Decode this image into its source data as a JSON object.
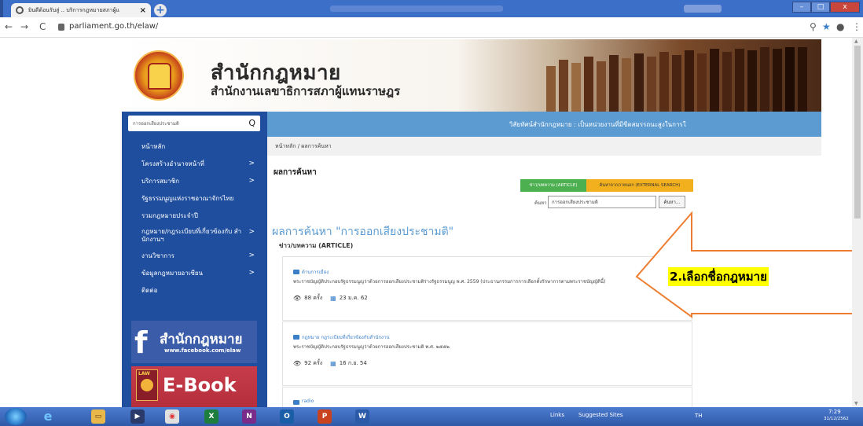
{
  "browser": {
    "tab_title": "ยินดีต้อนรับสู่ .. บริการกฎหมายสภาผู้แ",
    "tab_close": "×",
    "new_tab": "+",
    "back": "←",
    "forward": "→",
    "reload": "C",
    "url": "parliament.go.th/elaw/",
    "zoom_icon": "⚲",
    "star_icon": "★",
    "account_icon": "●",
    "menu_icon": "⋮",
    "min_label": "–",
    "max_label": "□",
    "close_label": "x"
  },
  "header": {
    "title": "สำนักกฎหมาย",
    "subtitle": "สำนักงานเลขาธิการสภาผู้แทนราษฎร"
  },
  "sidebar": {
    "search_value": "การออกเสียงประชามติ",
    "search_icon_glyph": "Q",
    "items": [
      {
        "label": "หน้าหลัก",
        "arrow": ""
      },
      {
        "label": "โครงสร้างอำนาจหน้าที่",
        "arrow": ">"
      },
      {
        "label": "บริการสมาชิก",
        "arrow": ">"
      },
      {
        "label": "รัฐธรรมนูญแห่งราชอาณาจักรไทย",
        "arrow": ""
      },
      {
        "label": "รวมกฎหมายประจำปี",
        "arrow": ""
      },
      {
        "label": "กฎหมาย/กฎระเบียบที่เกี่ยวข้องกับ สำนักงานฯ",
        "arrow": ">"
      },
      {
        "label": "งานวิชาการ",
        "arrow": ">"
      },
      {
        "label": "ข้อมูลกฎหมายอาเซียน",
        "arrow": ">"
      },
      {
        "label": "ติดต่อ",
        "arrow": ""
      }
    ],
    "fb_banner": {
      "letter": "f",
      "title": "สำนักกฎหมาย",
      "url": "www.facebook.com/elaw"
    },
    "ebook_banner": {
      "law": "LAW",
      "title": "E-Book"
    }
  },
  "main": {
    "ticker": "วิสัยทัศน์สำนักกฎหมาย : เป็นหน่วยงานที่มีขีดสมรรถนะสูงในการใ",
    "breadcrumb": "หน้าหลัก  /  ผลการค้นหา",
    "result_title": "ผลการค้นหา",
    "tab_article": "ข่าว/บทความ (ARTICLE)",
    "tab_external": "ค้นหาจากภายนอก (EXTERNAL SEARCH)",
    "find_label": "ค้นหา",
    "find_value": "การออกเสียงประชามติ",
    "find_button": "ค้นหา...",
    "search_heading": "ผลการค้นหา   \"การออกเสียงประชามติ\"",
    "category_title": "ข่าว/บทความ (ARTICLE)",
    "results": [
      {
        "category": "ด้านการเมือง",
        "desc": "พระราชบัญญัติประกอบรัฐธรรมนูญว่าด้วยการออกเสียงประชามติร่างรัฐธรรมนูญ พ.ศ. 2559 (ประธานกรรมการการเลือกตั้งรักษาการตามพระราชบัญญัตินี้)",
        "views": "88 ครั้ง",
        "date": "23 ม.ค. 62"
      },
      {
        "category": "กฎหมาย กฎระเบียบที่เกี่ยวข้องกับสำนักงาน",
        "desc": "พระราชบัญญัติประกอบรัฐธรรมนูญว่าด้วยการออกเสียงประชามติ พ.ศ. ๒๕๕๒",
        "views": "92 ครั้ง",
        "date": "16 ก.ย. 54"
      },
      {
        "category": "radio",
        "desc": "",
        "views": "",
        "date": ""
      }
    ]
  },
  "callout": {
    "text": "2.เลือกชื่อกฎหมาย",
    "color": "#ed7d31",
    "highlight": "#ffff00"
  },
  "taskbar": {
    "apps": [
      "e",
      "▭",
      "▶",
      "◉",
      "X",
      "N",
      "O",
      "P",
      "W"
    ],
    "links": "Links",
    "suggested": "Suggested Sites",
    "lang": "TH",
    "time": "7:29",
    "date": "31/12/2562"
  }
}
